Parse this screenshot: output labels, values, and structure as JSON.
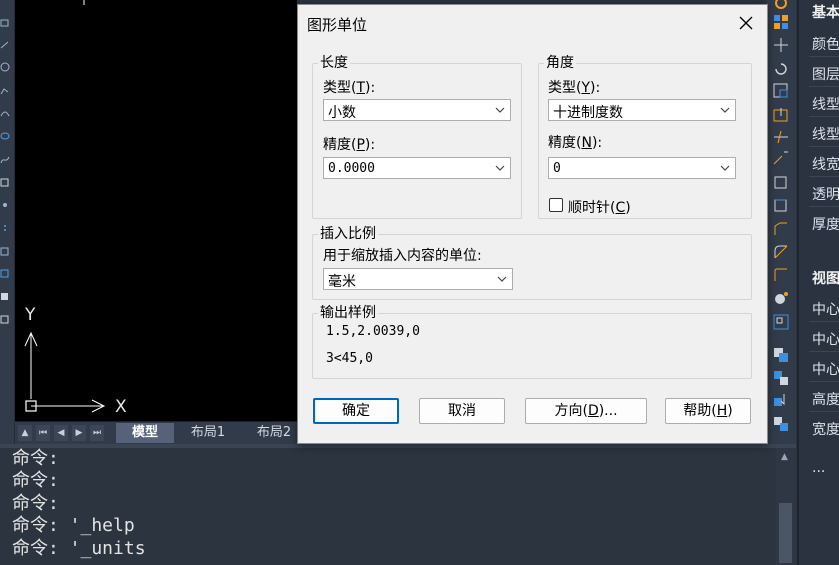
{
  "dialog": {
    "title": "图形单位",
    "length": {
      "group_title": "长度",
      "type_label": "类型",
      "type_key": "T",
      "type_value": "小数",
      "precision_label": "精度",
      "precision_key": "P",
      "precision_value": "0.0000"
    },
    "angle": {
      "group_title": "角度",
      "type_label": "类型",
      "type_key": "Y",
      "type_value": "十进制度数",
      "precision_label": "精度",
      "precision_key": "N",
      "precision_value": "0",
      "clockwise_label": "顺时针",
      "clockwise_key": "C",
      "clockwise_checked": false
    },
    "insert_scale": {
      "group_title": "插入比例",
      "units_label": "用于缩放插入内容的单位:",
      "units_value": "毫米"
    },
    "sample": {
      "group_title": "输出样例",
      "line1": "1.5,2.0039,0",
      "line2": "3<45,0"
    },
    "buttons": {
      "ok": "确定",
      "cancel": "取消",
      "direction": "方向(D)...",
      "direction_text": "方向",
      "direction_key": "D",
      "help_text": "帮助",
      "help_key": "H"
    }
  },
  "canvas": {
    "axis_y": "Y",
    "axis_x": "X"
  },
  "tabs": [
    "模型",
    "布局1",
    "布局2"
  ],
  "command_lines": [
    "命令:",
    "命令:",
    "命令:",
    "命令: '_help",
    "命令: '_units"
  ],
  "properties": {
    "header_basic": "基本",
    "items": [
      "颜色",
      "图层",
      "线型",
      "线型",
      "线宽",
      "透明",
      "厚度"
    ],
    "header_view": "视图",
    "view_items": [
      "中心",
      "中心",
      "中心",
      "高度",
      "宽度"
    ],
    "more": "..."
  },
  "colors": {
    "accent": "#0067c0",
    "canvas": "#000000",
    "panel": "#2b3340"
  }
}
